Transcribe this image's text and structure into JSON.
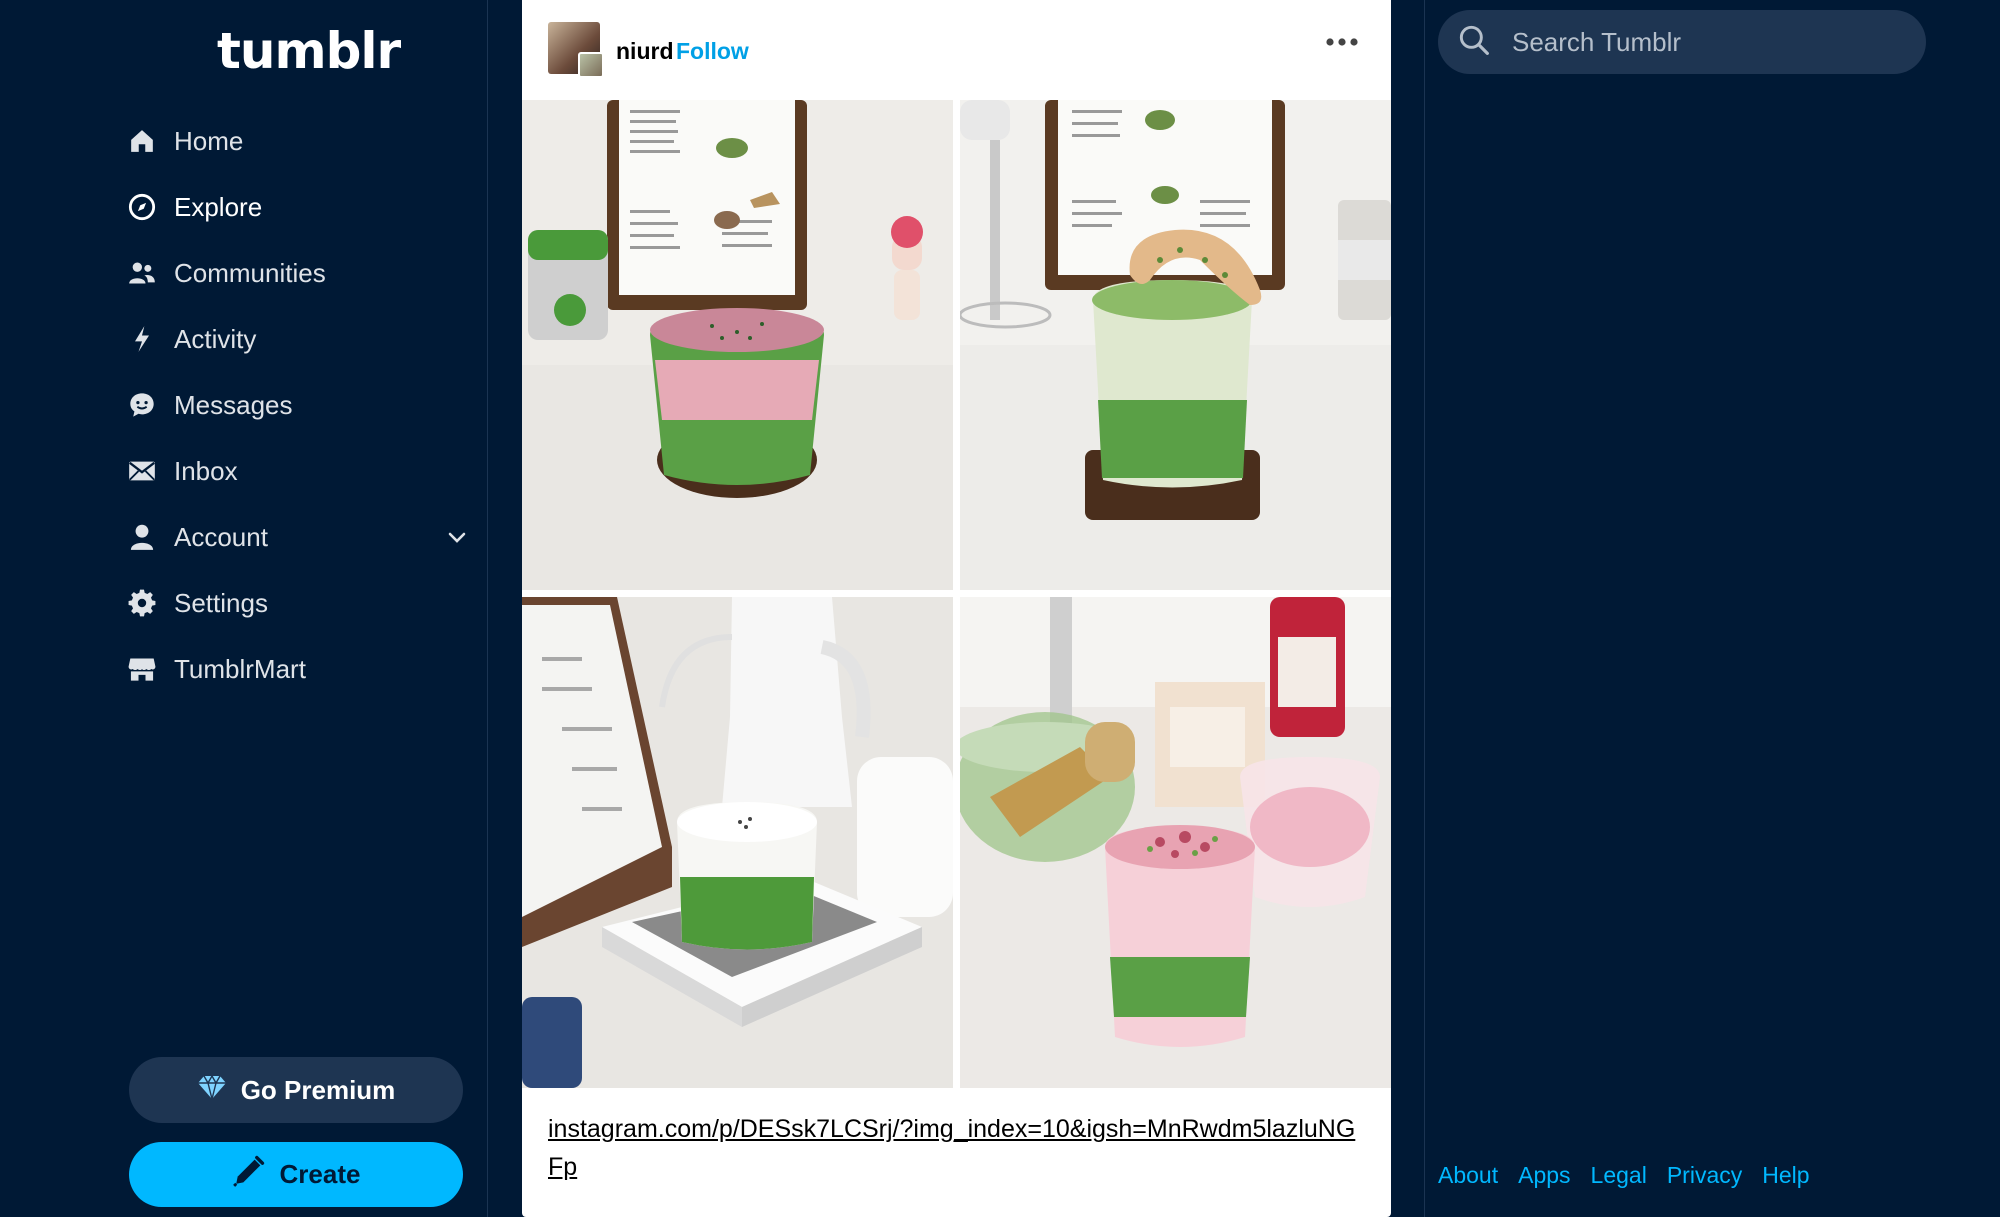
{
  "brand": {
    "logo_text": "tumblr"
  },
  "sidebar": {
    "items": [
      {
        "label": "Home",
        "icon": "home-icon"
      },
      {
        "label": "Explore",
        "icon": "compass-icon",
        "active": true
      },
      {
        "label": "Communities",
        "icon": "people-icon"
      },
      {
        "label": "Activity",
        "icon": "lightning-icon"
      },
      {
        "label": "Messages",
        "icon": "chat-bubble-icon"
      },
      {
        "label": "Inbox",
        "icon": "envelope-icon"
      },
      {
        "label": "Account",
        "icon": "person-icon",
        "expandable": true
      },
      {
        "label": "Settings",
        "icon": "gear-icon"
      },
      {
        "label": "TumblrMart",
        "icon": "storefront-icon"
      }
    ],
    "premium_label": "Go Premium",
    "create_label": "Create"
  },
  "post": {
    "username": "niurd",
    "follow_label": "Follow",
    "link_text": "instagram.com/p/DESsk7LCSrj/?img_index=10&igsh=MnRwdm5lazluNGFp"
  },
  "search": {
    "placeholder": "Search Tumblr"
  },
  "footer": {
    "links": [
      "About",
      "Apps",
      "Legal",
      "Privacy",
      "Help"
    ]
  },
  "colors": {
    "background": "#001935",
    "accent": "#00b8ff",
    "follow": "#00a0e6",
    "panel": "#1e3552"
  }
}
